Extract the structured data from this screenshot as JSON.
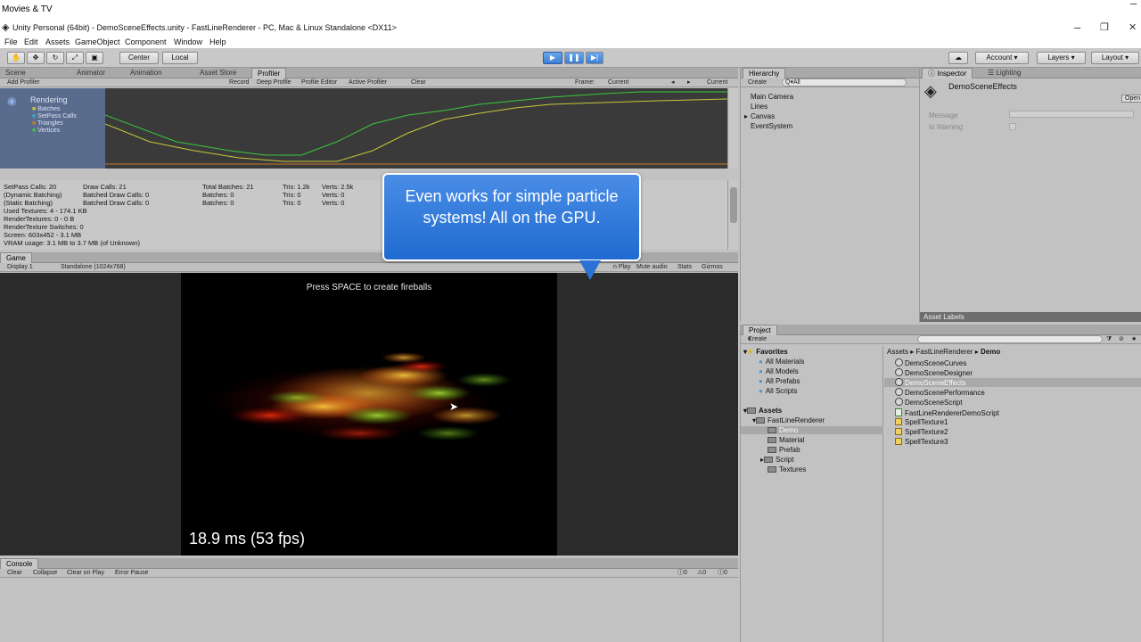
{
  "os": {
    "app_title": "Movies & TV"
  },
  "unity": {
    "window_title": "Unity Personal (64bit) - DemoSceneEffects.unity - FastLineRenderer - PC, Mac & Linux Standalone <DX11>",
    "menu": [
      "File",
      "Edit",
      "Assets",
      "GameObject",
      "Component",
      "Window",
      "Help"
    ]
  },
  "toolbar": {
    "center": "Center",
    "local": "Local",
    "account": "Account",
    "layers": "Layers",
    "layout": "Layout"
  },
  "profiler": {
    "tabs": [
      "Scene",
      "Animator",
      "Animation",
      "Asset Store",
      "Profiler"
    ],
    "add_profiler": "Add Profiler",
    "toolbar": [
      "Record",
      "Deep Profile",
      "Profile Editor",
      "Active Profiler",
      "Clear"
    ],
    "frame_label": "Frame:",
    "frame_value": "Current",
    "current_btn": "Current",
    "category": "Rendering",
    "legend": [
      "Batches",
      "SetPass Calls",
      "Triangles",
      "Vertices"
    ],
    "legend_colors": [
      "#c8c83a",
      "#3aa8c8",
      "#c87a2a",
      "#3ac83a"
    ],
    "stats_col1": "SetPass Calls: 20\n(Dynamic Batching)\n(Static Batching)\nUsed Textures: 4 - 174.1 KB\nRenderTextures: 0 - 0 B\nRenderTexture Switches: 0\nScreen: 603x452 - 3.1 MB\nVRAM usage: 3.1 MB to 3.7 MB (of Unknown)",
    "stats_col2": "Draw Calls: 21\nBatched Draw Calls: 0\nBatched Draw Calls: 0",
    "stats_col3": "Total Batches: 21\nBatches: 0\nBatches: 0",
    "stats_col4": "Tris: 1.2k\nTris: 0\nTris: 0",
    "stats_col5": "Verts: 2.5k\nVerts: 0\nVerts: 0"
  },
  "game": {
    "tab": "Game",
    "display": "Display 1",
    "resolution": "Standalone (1024x768)",
    "controls": [
      "Maximize on Play",
      "Mute audio",
      "Stats",
      "Gizmos"
    ],
    "maximize_partial": "n Play",
    "hint": "Press SPACE to create fireballs",
    "fps": "18.9 ms (53 fps)"
  },
  "callout": {
    "text": "Even works for simple particle systems! All on the GPU."
  },
  "hierarchy": {
    "tab": "Hierarchy",
    "create": "Create",
    "search_placeholder": "Q▾All",
    "items": [
      "Main Camera",
      "Lines",
      "Canvas",
      "EventSystem"
    ]
  },
  "inspector": {
    "tabs": [
      "Inspector",
      "Lighting"
    ],
    "object_name": "DemoSceneEffects",
    "open_btn": "Open",
    "fields": [
      "Message",
      "Is Warning"
    ],
    "asset_labels": "Asset Labels"
  },
  "project": {
    "tab": "Project",
    "create": "Create",
    "favorites_label": "Favorites",
    "favorites": [
      "All Materials",
      "All Models",
      "All Prefabs",
      "All Scripts"
    ],
    "assets_label": "Assets",
    "tree": [
      "FastLineRenderer",
      "Demo",
      "Material",
      "Prefab",
      "Script",
      "Textures"
    ],
    "breadcrumb": [
      "Assets",
      "FastLineRenderer",
      "Demo"
    ],
    "files": [
      "DemoSceneCurves",
      "DemoSceneDesigner",
      "DemoSceneEffects",
      "DemoScenePerformance",
      "DemoSceneScript",
      "FastLineRendererDemoScript",
      "SpellTexture1",
      "SpellTexture2",
      "SpellTexture3"
    ]
  },
  "console": {
    "tab": "Console",
    "buttons": [
      "Clear",
      "Collapse",
      "Clear on Play",
      "Error Pause"
    ],
    "counts": [
      "0",
      "0",
      "0"
    ]
  }
}
